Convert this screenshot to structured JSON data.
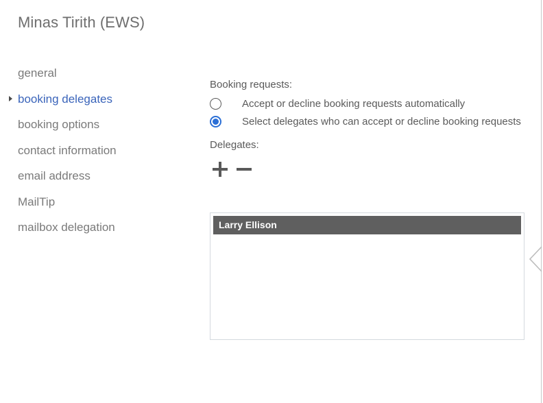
{
  "header": {
    "title": "Minas Tirith (EWS)"
  },
  "sidebar": {
    "items": [
      {
        "label": "general",
        "selected": false
      },
      {
        "label": "booking delegates",
        "selected": true
      },
      {
        "label": "booking options",
        "selected": false
      },
      {
        "label": "contact information",
        "selected": false
      },
      {
        "label": "email address",
        "selected": false
      },
      {
        "label": "MailTip",
        "selected": false
      },
      {
        "label": "mailbox delegation",
        "selected": false
      }
    ]
  },
  "main": {
    "booking_requests_label": "Booking requests:",
    "options": [
      {
        "label": "Accept or decline booking requests automatically",
        "checked": false
      },
      {
        "label": "Select delegates who can accept or decline booking requests",
        "checked": true
      }
    ],
    "delegates_label": "Delegates:",
    "toolbar": {
      "add_icon": "plus-icon",
      "remove_icon": "minus-icon"
    },
    "delegates": [
      {
        "name": "Larry Ellison",
        "selected": true
      }
    ]
  },
  "edge": {
    "collapse_icon": "chevron-left-icon"
  },
  "colors": {
    "accent_blue": "#3a64ba",
    "radio_blue": "#2b6fd6",
    "selection_gray": "#5f5f5f",
    "text_gray": "#5a5a5a",
    "nav_gray": "#7a7a7a",
    "title_gray": "#6e6e6e",
    "border_gray": "#d4d9de"
  }
}
